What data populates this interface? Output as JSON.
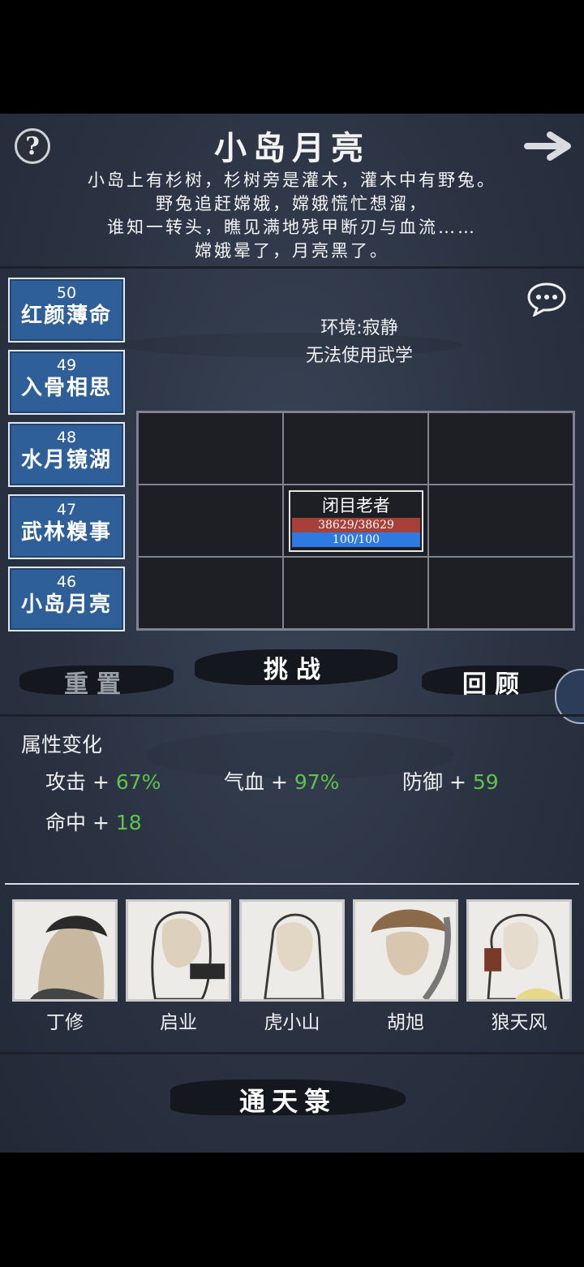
{
  "header": {
    "title": "小岛月亮",
    "story_lines": [
      "小岛上有杉树，杉树旁是灌木，灌木中有野兔。",
      "野兔追赶嫦娥，嫦娥慌忙想溜，",
      "谁知一转头，瞧见满地残甲断刃与血流……",
      "嫦娥晕了，月亮黑了。"
    ]
  },
  "levels": [
    {
      "num": "50",
      "name": "红颜薄命"
    },
    {
      "num": "49",
      "name": "入骨相思"
    },
    {
      "num": "48",
      "name": "水月镜湖"
    },
    {
      "num": "47",
      "name": "武林糗事"
    },
    {
      "num": "46",
      "name": "小岛月亮"
    }
  ],
  "environment": {
    "line1": "环境:寂静",
    "line2": "无法使用武学"
  },
  "enemy": {
    "name": "闭目老者",
    "hp": "38629/38629",
    "mp": "100/100"
  },
  "buttons": {
    "challenge": "挑战",
    "reset": "重置",
    "review": "回顾",
    "tongtian": "通天箓"
  },
  "attributes": {
    "title": "属性变化",
    "items": [
      {
        "label": "攻击 + ",
        "value": "67%"
      },
      {
        "label": "气血 + ",
        "value": "97%"
      },
      {
        "label": "防御 + ",
        "value": "59"
      },
      {
        "label": "命中 + ",
        "value": "18"
      }
    ]
  },
  "heroes": [
    {
      "name": "丁修"
    },
    {
      "name": "启业"
    },
    {
      "name": "虎小山"
    },
    {
      "name": "胡旭"
    },
    {
      "name": "狼天风"
    }
  ],
  "colors": {
    "level_blue": "#2f5f98",
    "hp_red": "#a8403a",
    "mp_blue": "#2e7ae0",
    "stat_green": "#5ec34d"
  }
}
